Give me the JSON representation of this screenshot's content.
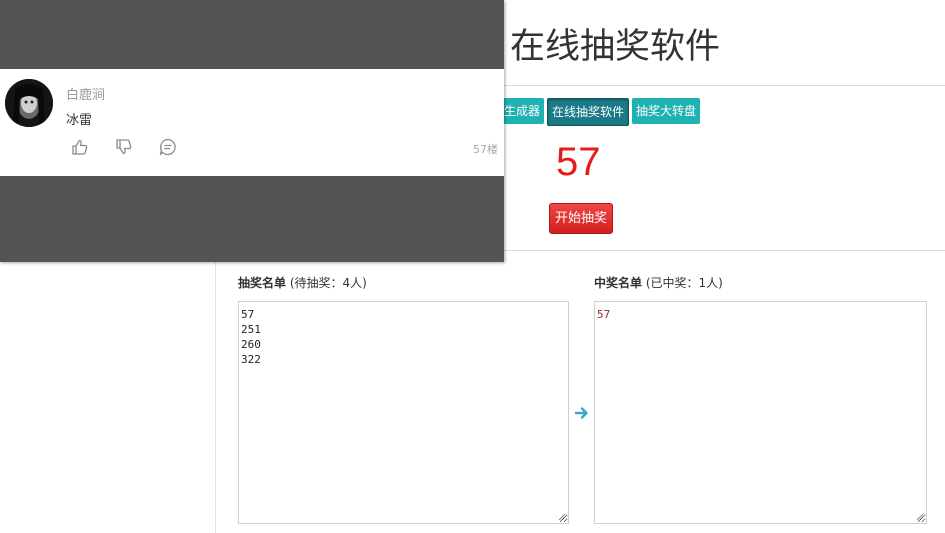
{
  "page": {
    "title": "在线抽奖软件",
    "nav": [
      {
        "label": "生成器"
      },
      {
        "label": "在线抽奖软件"
      },
      {
        "label": "抽奖大转盘"
      }
    ],
    "result_number": "57",
    "start_button": "开始抽奖",
    "pool": {
      "label_bold": "抽奖名单",
      "label_note": " (待抽奖：4人)",
      "entries": "57\n251\n260\n322"
    },
    "winners": {
      "label_bold": "中奖名单",
      "label_note": " (已中奖：1人)",
      "entries": "57"
    }
  },
  "comment": {
    "username": "白鹿涧",
    "text": "冰雷",
    "floor": "57楼",
    "actions": [
      "thumbs-up-icon",
      "thumbs-down-icon",
      "reply-icon"
    ]
  },
  "colors": {
    "teal": "#20b2b2",
    "active_nav": "#1a7a86",
    "result_red": "#e51c1c",
    "start_red": "#d21e1e",
    "overlay_gray": "#545454"
  }
}
